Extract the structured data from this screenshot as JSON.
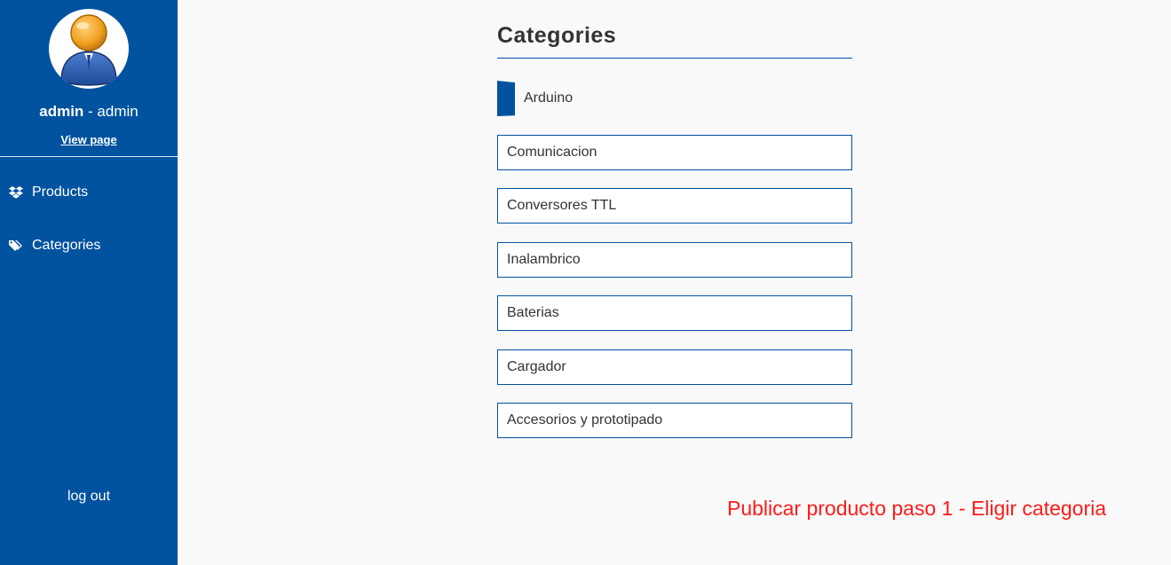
{
  "sidebar": {
    "user": {
      "name": "admin",
      "separator": " - ",
      "role": "admin"
    },
    "view_page_label": "View page",
    "nav": [
      {
        "label": "Products",
        "icon": "dropbox-icon"
      },
      {
        "label": "Categories",
        "icon": "tags-icon"
      }
    ],
    "logout_label": "log out"
  },
  "main": {
    "title": "Categories",
    "selected_category": "Arduino",
    "categories": [
      "Comunicacion",
      "Conversores TTL",
      "Inalambrico",
      "Baterias",
      "Cargador",
      "Accesorios y prototipado"
    ]
  },
  "footer_note": "Publicar producto paso 1 - Eligir categoria",
  "colors": {
    "sidebar_bg": "#01529f",
    "accent": "#01529f",
    "note": "#ff1a1a"
  }
}
